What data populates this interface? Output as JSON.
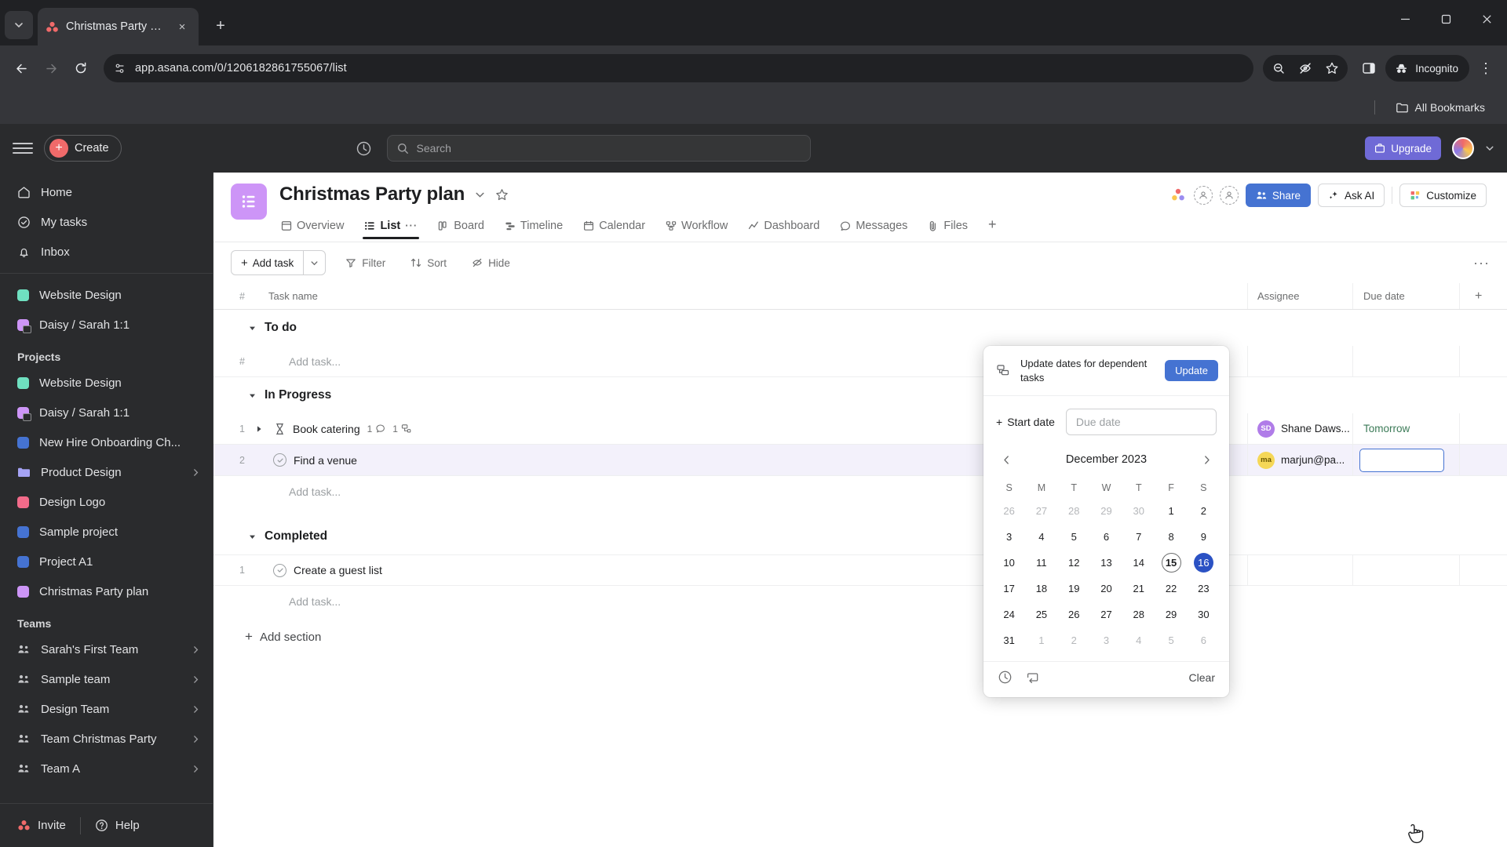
{
  "browser": {
    "tab": {
      "title": "Christmas Party plan - Asana",
      "favicon": "asana-logo-icon",
      "close": "×"
    },
    "new_tab_label": "+",
    "window": {
      "minimize": "—",
      "maximize": "▢",
      "close": "✕"
    },
    "nav": {
      "back": "←",
      "forward": "→",
      "reload": "⟳"
    },
    "url": "app.asana.com/0/1206182861755067/list",
    "omnibox_icon": "site-settings-icon",
    "right_icons": [
      "zoom-out-icon",
      "eye-off-icon",
      "bookmark-star-icon",
      "side-panel-icon"
    ],
    "incognito_label": "Incognito",
    "menu": "⋮",
    "bookmarks": {
      "all_bookmarks": "All Bookmarks"
    }
  },
  "asana_top": {
    "create_label": "Create",
    "search_placeholder": "Search",
    "upgrade_label": "Upgrade",
    "clock_icon": "recent-activity-icon",
    "menu_icon": "main-menu-icon"
  },
  "sidebar": {
    "nav": [
      {
        "label": "Home",
        "icon": "home-icon"
      },
      {
        "label": "My tasks",
        "icon": "check-circle-icon"
      },
      {
        "label": "Inbox",
        "icon": "bell-icon"
      }
    ],
    "favorites": [
      {
        "label": "Website Design",
        "color": "#6fe0c0",
        "locked": false
      },
      {
        "label": "Daisy / Sarah 1:1",
        "color": "#cd95f7",
        "locked": true
      }
    ],
    "projects_header": "Projects",
    "projects": [
      {
        "label": "Website Design",
        "color": "#6fe0c0",
        "locked": false,
        "chevron": false,
        "folder": false
      },
      {
        "label": "Daisy / Sarah 1:1",
        "color": "#cd95f7",
        "locked": true,
        "chevron": false,
        "folder": false
      },
      {
        "label": "New Hire Onboarding Ch...",
        "color": "#4573d2",
        "locked": false,
        "chevron": false,
        "folder": false
      },
      {
        "label": "Product Design",
        "color": "#a5a3f5",
        "locked": false,
        "chevron": true,
        "folder": true
      },
      {
        "label": "Design Logo",
        "color": "#f26b8a",
        "locked": false,
        "chevron": false,
        "folder": false
      },
      {
        "label": "Sample project",
        "color": "#4573d2",
        "locked": false,
        "chevron": false,
        "folder": false
      },
      {
        "label": "Project A1",
        "color": "#4573d2",
        "locked": false,
        "chevron": false,
        "folder": false
      },
      {
        "label": "Christmas Party plan",
        "color": "#cd95f7",
        "locked": false,
        "chevron": false,
        "folder": false
      }
    ],
    "teams_header": "Teams",
    "teams": [
      {
        "label": "Sarah's First Team"
      },
      {
        "label": "Sample team"
      },
      {
        "label": "Design Team"
      },
      {
        "label": "Team Christmas Party"
      },
      {
        "label": "Team A"
      }
    ],
    "footer": {
      "invite": "Invite",
      "help": "Help"
    }
  },
  "project": {
    "title": "Christmas Party plan",
    "icon": "list-project-icon",
    "dropdown_icon": "chevron-down-icon",
    "star_icon": "star-icon",
    "tabs": [
      {
        "label": "Overview",
        "icon": "overview-icon",
        "active": false
      },
      {
        "label": "List",
        "icon": "list-icon",
        "active": true
      },
      {
        "label": "Board",
        "icon": "board-icon",
        "active": false
      },
      {
        "label": "Timeline",
        "icon": "timeline-icon",
        "active": false
      },
      {
        "label": "Calendar",
        "icon": "calendar-icon",
        "active": false
      },
      {
        "label": "Workflow",
        "icon": "workflow-icon",
        "active": false
      },
      {
        "label": "Dashboard",
        "icon": "dashboard-icon",
        "active": false
      },
      {
        "label": "Messages",
        "icon": "messages-icon",
        "active": false
      },
      {
        "label": "Files",
        "icon": "files-icon",
        "active": false
      }
    ],
    "tab_add": "+",
    "tab_more": "···",
    "header_actions": {
      "share": "Share",
      "ask_ai": "Ask AI",
      "customize": "Customize"
    }
  },
  "toolbar": {
    "add_task": "Add task",
    "add_task_caret": "⌄",
    "filter": "Filter",
    "sort": "Sort",
    "hide": "Hide",
    "more": "···"
  },
  "table": {
    "columns": {
      "num": "#",
      "task_name": "Task name",
      "assignee": "Assignee",
      "due_date": "Due date",
      "add": "+"
    },
    "add_task_placeholder": "Add task...",
    "sections": [
      {
        "name": "To do",
        "rows": [],
        "show_num_placeholder": true
      },
      {
        "name": "In Progress",
        "rows": [
          {
            "num": "1",
            "name": "Book catering",
            "expandable": true,
            "status_icon": "hourglass-icon",
            "comments": "1",
            "subtasks": "1",
            "assignee": {
              "initials": "SD",
              "name": "Shane Daws...",
              "color": "#b07ce8"
            },
            "due": "Tomorrow",
            "selected": false,
            "editing_due": false
          },
          {
            "num": "2",
            "name": "Find a venue",
            "expandable": false,
            "status_icon": "check-circle-icon",
            "comments": "",
            "subtasks": "",
            "assignee": {
              "initials": "ma",
              "name": "marjun@pa...",
              "color": "#f5d757"
            },
            "due": "",
            "selected": true,
            "editing_due": true
          }
        ],
        "show_num_placeholder": false
      },
      {
        "name": "Completed",
        "rows": [
          {
            "num": "1",
            "name": "Create a guest list",
            "expandable": false,
            "status_icon": "check-circle-icon",
            "comments": "",
            "subtasks": "",
            "assignee": {
              "initials": "",
              "name": "",
              "color": ""
            },
            "due": "",
            "selected": false,
            "editing_due": false
          }
        ],
        "show_num_placeholder": false
      }
    ],
    "add_section": "Add section"
  },
  "date_picker": {
    "banner_text": "Update dates for dependent tasks",
    "banner_icon": "dependency-icon",
    "update_button": "Update",
    "start_date_label": "Start date",
    "start_date_plus": "+",
    "due_date_placeholder": "Due date",
    "prev_icon": "chevron-left-icon",
    "next_icon": "chevron-right-icon",
    "month_label": "December 2023",
    "weekdays": [
      "S",
      "M",
      "T",
      "W",
      "T",
      "F",
      "S"
    ],
    "weeks": [
      [
        {
          "d": "26",
          "muted": true
        },
        {
          "d": "27",
          "muted": true
        },
        {
          "d": "28",
          "muted": true
        },
        {
          "d": "29",
          "muted": true
        },
        {
          "d": "30",
          "muted": true
        },
        {
          "d": "1",
          "muted": false
        },
        {
          "d": "2",
          "muted": false
        }
      ],
      [
        {
          "d": "3",
          "muted": false
        },
        {
          "d": "4",
          "muted": false
        },
        {
          "d": "5",
          "muted": false
        },
        {
          "d": "6",
          "muted": false
        },
        {
          "d": "7",
          "muted": false
        },
        {
          "d": "8",
          "muted": false
        },
        {
          "d": "9",
          "muted": false
        }
      ],
      [
        {
          "d": "10",
          "muted": false
        },
        {
          "d": "11",
          "muted": false
        },
        {
          "d": "12",
          "muted": false
        },
        {
          "d": "13",
          "muted": false
        },
        {
          "d": "14",
          "muted": false
        },
        {
          "d": "15",
          "muted": false,
          "today": true
        },
        {
          "d": "16",
          "muted": false,
          "selected": true
        }
      ],
      [
        {
          "d": "17",
          "muted": false
        },
        {
          "d": "18",
          "muted": false
        },
        {
          "d": "19",
          "muted": false
        },
        {
          "d": "20",
          "muted": false
        },
        {
          "d": "21",
          "muted": false
        },
        {
          "d": "22",
          "muted": false
        },
        {
          "d": "23",
          "muted": false
        }
      ],
      [
        {
          "d": "24",
          "muted": false
        },
        {
          "d": "25",
          "muted": false
        },
        {
          "d": "26",
          "muted": false
        },
        {
          "d": "27",
          "muted": false
        },
        {
          "d": "28",
          "muted": false
        },
        {
          "d": "29",
          "muted": false
        },
        {
          "d": "30",
          "muted": false
        }
      ],
      [
        {
          "d": "31",
          "muted": false
        },
        {
          "d": "1",
          "muted": true
        },
        {
          "d": "2",
          "muted": true
        },
        {
          "d": "3",
          "muted": true
        },
        {
          "d": "4",
          "muted": true
        },
        {
          "d": "5",
          "muted": true
        },
        {
          "d": "6",
          "muted": true
        }
      ]
    ],
    "time_icon": "clock-icon",
    "repeat_icon": "repeat-icon",
    "clear_label": "Clear",
    "accent_selected": "#2b52c4"
  }
}
